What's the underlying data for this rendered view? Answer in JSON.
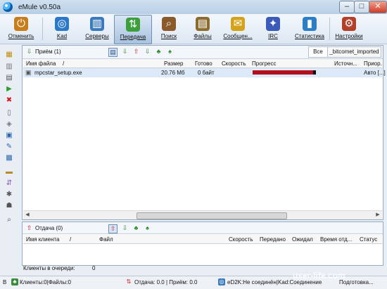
{
  "title": "eMule v0.50a",
  "toolbar": [
    {
      "label": "Отменить",
      "icon": "disconnect-icon",
      "color": "#c77d1a",
      "glyph": "⏻"
    },
    {
      "label": "Kad",
      "icon": "kad-icon",
      "color": "#2b78c7",
      "glyph": "◎"
    },
    {
      "label": "Серверы",
      "icon": "servers-icon",
      "color": "#3b7bbd",
      "glyph": "▥"
    },
    {
      "label": "Передача",
      "icon": "transfer-icon",
      "color": "#3c9e3c",
      "glyph": "⇅"
    },
    {
      "label": "Поиск",
      "icon": "search-icon",
      "color": "#8b5a2b",
      "glyph": "⌕"
    },
    {
      "label": "Файлы",
      "icon": "shared-files-icon",
      "color": "#8c6b2f",
      "glyph": "▤"
    },
    {
      "label": "Сообщен...",
      "icon": "messages-icon",
      "color": "#d3a21a",
      "glyph": "✉"
    },
    {
      "label": "IRC",
      "icon": "irc-icon",
      "color": "#3b5bb8",
      "glyph": "✦"
    },
    {
      "label": "Статистика",
      "icon": "statistics-icon",
      "color": "#2c7fc5",
      "glyph": "▮"
    },
    {
      "label": "Настройки",
      "icon": "settings-icon",
      "color": "#b33f29",
      "glyph": "⚙"
    }
  ],
  "downloads": {
    "title": "Приём (1)",
    "filter_all": "Все",
    "filter_category": "_bitcomet_imported",
    "headers": [
      "Имя файла",
      "/",
      "Размер",
      "Готово",
      "Скорость",
      "Прогресс",
      "Источн...",
      "Приор."
    ],
    "rows": [
      {
        "name": "mpcstar_setup.exe",
        "size": "20.76 Мб",
        "done": "0 байт",
        "speed": "",
        "progress": 0.95,
        "sources": "",
        "priority": "Авто [...]"
      }
    ]
  },
  "uploads": {
    "title": "Отдача (0)",
    "headers": [
      "Имя клиента",
      "/",
      "Файл",
      "Скорость",
      "Передано",
      "Ожидал",
      "Время отд...",
      "Статус"
    ]
  },
  "queue": {
    "label": "Клиенты в очереди:",
    "value": "0"
  },
  "statusbar": {
    "left": "В",
    "clients": "Клиенты:0|Файлы:0",
    "transfer": "Отдача: 0.0 | Приём: 0.0",
    "network": "eD2K:Не соединён|Kad:Соединение",
    "prep": "Подготовка..."
  },
  "watermark": "user-life.com"
}
